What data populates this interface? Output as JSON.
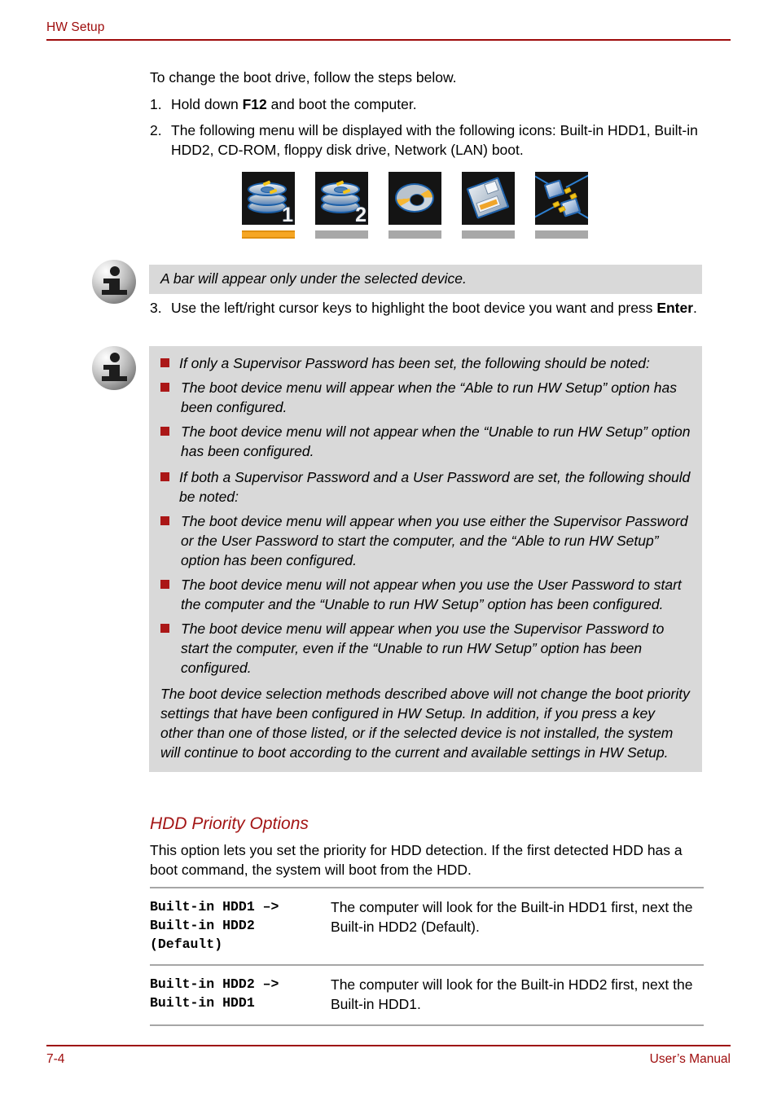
{
  "header": {
    "title": "HW Setup"
  },
  "intro": {
    "line": "To change the boot drive, follow the steps below."
  },
  "steps": [
    {
      "num": "1.",
      "pre": "Hold down ",
      "bold": "F12",
      "post": " and boot the computer."
    },
    {
      "num": "2.",
      "pre": "The following menu will be displayed with the following icons: Built-in HDD1, Built-in HDD2, CD-ROM, floppy disk drive, Network (LAN) boot.",
      "bold": "",
      "post": ""
    },
    {
      "num": "3.",
      "pre": "Use the left/right cursor keys to highlight the boot device you want and press ",
      "bold": "Enter",
      "post": "."
    }
  ],
  "boot_icons": [
    {
      "name": "built-in-hdd1-icon",
      "label": "Built-in HDD1",
      "badge": "1",
      "selected": true
    },
    {
      "name": "built-in-hdd2-icon",
      "label": "Built-in HDD2",
      "badge": "2",
      "selected": false
    },
    {
      "name": "cd-rom-icon",
      "label": "CD-ROM",
      "badge": "",
      "selected": false
    },
    {
      "name": "floppy-disk-icon",
      "label": "floppy disk drive",
      "badge": "",
      "selected": false
    },
    {
      "name": "network-lan-icon",
      "label": "Network (LAN) boot",
      "badge": "",
      "selected": false
    }
  ],
  "note1": {
    "text": "A bar will appear only under the selected device."
  },
  "note2": {
    "items": [
      {
        "text": "If only a Supervisor Password has been set, the following should be noted:",
        "sub": [
          "The boot device menu will appear when the “Able to run HW Setup” option has been configured.",
          "The boot device menu will not appear when the “Unable to run HW Setup” option has been configured."
        ]
      },
      {
        "text": "If both a Supervisor Password and a User Password are set, the following should be noted:",
        "sub": [
          "The boot device menu will appear when you use either the Supervisor Password or the User Password to start the computer, and the “Able to run HW Setup” option has been configured.",
          "The boot device menu will not appear when you use the User Password to start the computer and the “Unable to run HW Setup” option has been configured.",
          "The boot device menu will appear when you use the Supervisor Password to start the computer, even if the “Unable to run HW Setup” option has been configured."
        ]
      }
    ],
    "tail": "The boot device selection methods described above will not change the boot priority settings that have been configured in HW Setup. In addition, if you press a key other than one of those listed, or if the selected device is not installed, the system will continue to boot according to the current and available settings in HW Setup."
  },
  "section": {
    "heading": "HDD Priority Options",
    "body": "This option lets you set the priority for HDD detection. If the first detected HDD has a boot command, the system will boot from the HDD."
  },
  "options_table": {
    "rows": [
      {
        "key": "Built-in HDD1 –>\nBuilt-in HDD2\n(Default)",
        "desc": "The computer will look for the Built-in HDD1 first, next the Built-in HDD2 (Default)."
      },
      {
        "key": "Built-in HDD2 –>\nBuilt-in HDD1",
        "desc": "The computer will look for the Built-in HDD2 first, next the Built-in HDD1."
      }
    ]
  },
  "footer": {
    "page_number": "7-4",
    "manual_label": "User’s Manual"
  },
  "colors": {
    "brand_red": "#9e0b0b",
    "heading_red": "#a31515",
    "bullet_red": "#ab1717",
    "note_bg": "#d9d9d9",
    "selected_bar": "#f6a623",
    "unselected_bar": "#a8a8a8"
  }
}
